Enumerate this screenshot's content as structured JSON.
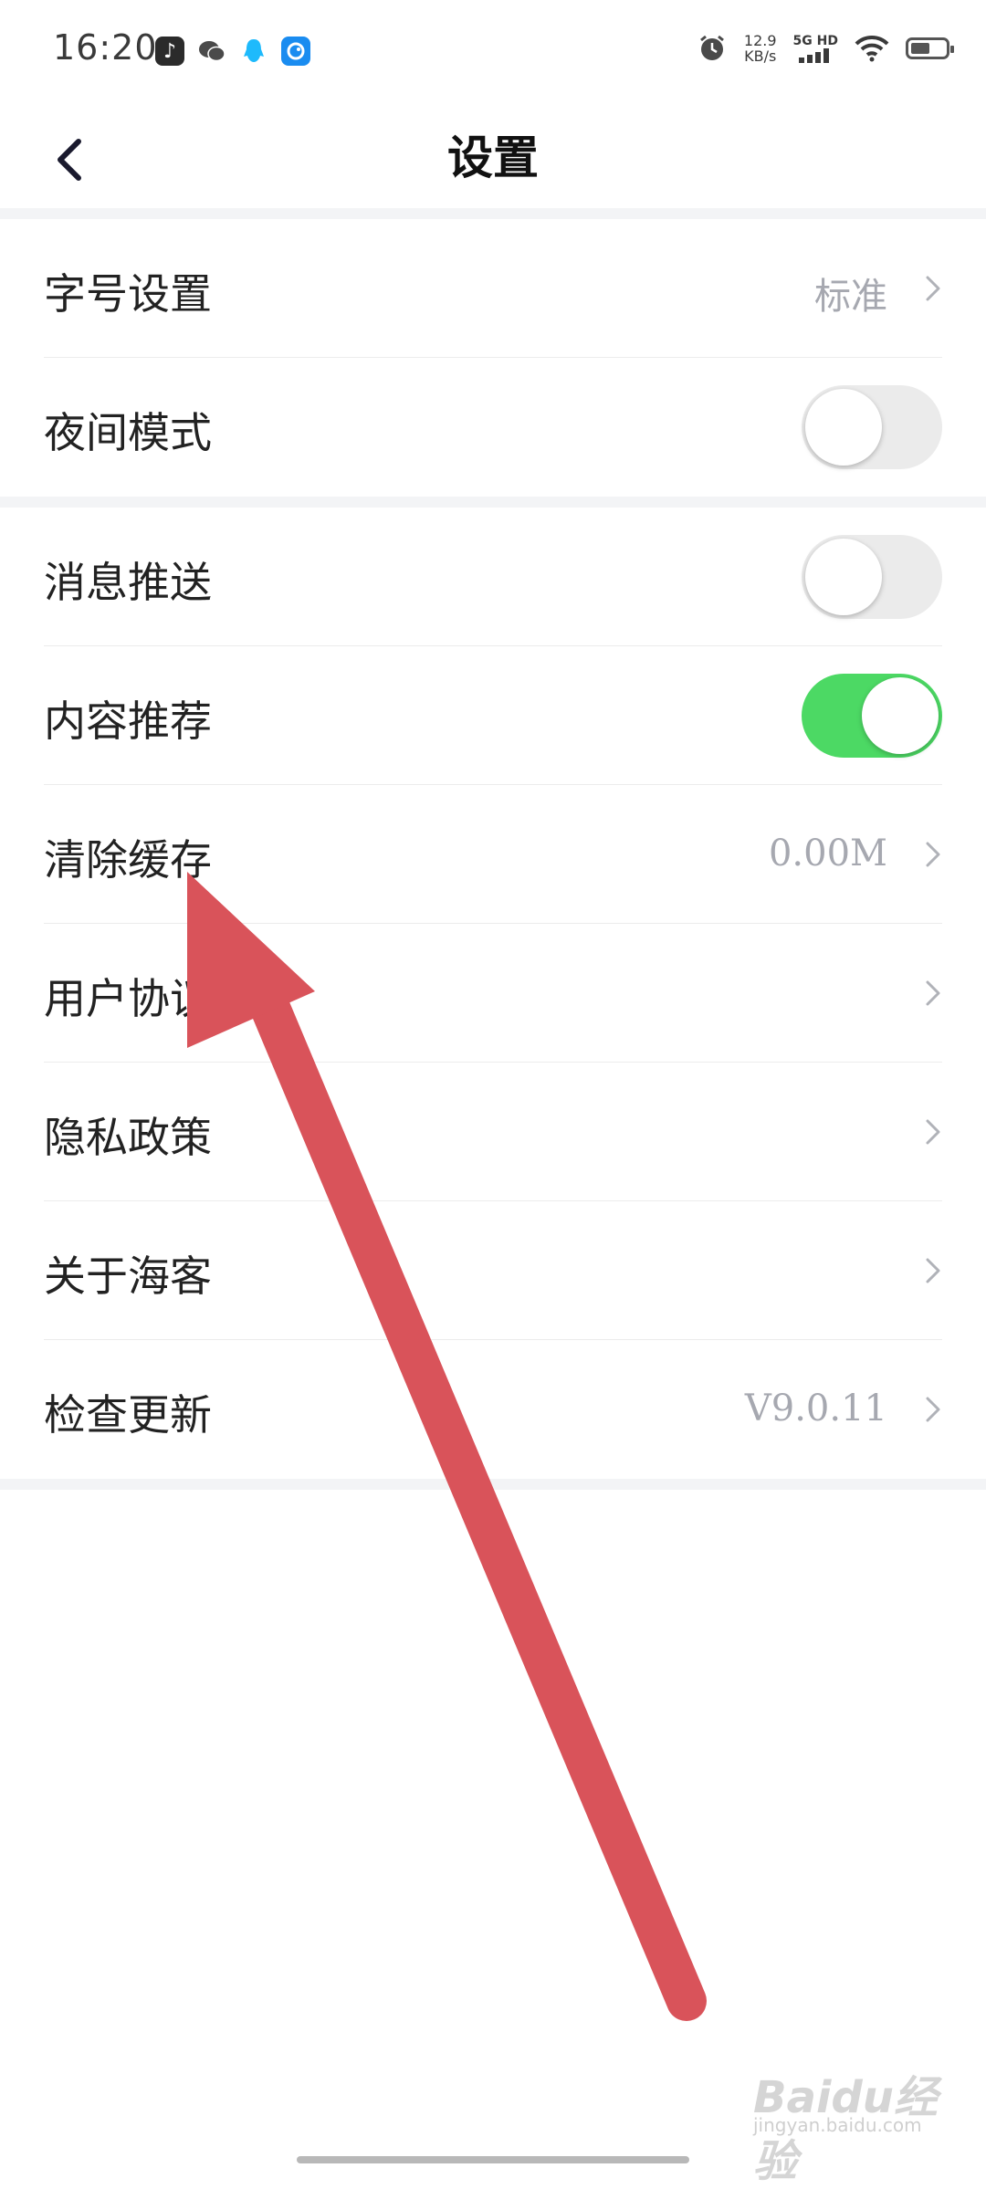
{
  "status_bar": {
    "time": "16:20",
    "net_speed_value": "12.9",
    "net_speed_unit": "KB/s",
    "network_type": "5G HD",
    "app_icons": [
      "music-app-icon",
      "wechat-icon",
      "qq-icon",
      "app-icon"
    ],
    "battery_level": 0.55
  },
  "header": {
    "title": "设置"
  },
  "settings": {
    "font_size": {
      "label": "字号设置",
      "value": "标准"
    },
    "night_mode": {
      "label": "夜间模式",
      "enabled": false
    },
    "push_notifications": {
      "label": "消息推送",
      "enabled": false
    },
    "content_recommend": {
      "label": "内容推荐",
      "enabled": true
    },
    "clear_cache": {
      "label": "清除缓存",
      "value": "0.00M"
    },
    "user_agreement": {
      "label": "用户协议"
    },
    "privacy_policy": {
      "label": "隐私政策"
    },
    "about": {
      "label": "关于海客"
    },
    "check_update": {
      "label": "检查更新",
      "value": "V9.0.11"
    }
  },
  "annotation": {
    "arrow_color": "#d9535a"
  },
  "watermark": {
    "brand": "Baidu经验",
    "domain": "jingyan.baidu.com"
  },
  "colors": {
    "toggle_on": "#4cd964",
    "toggle_off": "#ebebeb",
    "secondary_text": "#a6a8b0"
  }
}
